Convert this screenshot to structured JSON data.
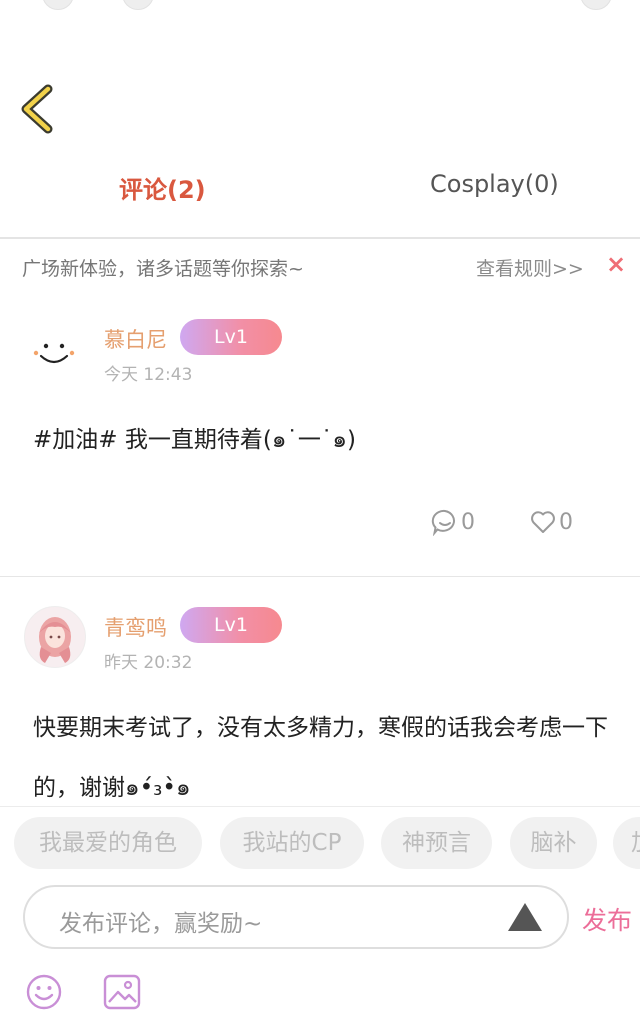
{
  "tabs": [
    {
      "label": "评论(2)",
      "active": true
    },
    {
      "label": "Cosplay(0)",
      "active": false
    }
  ],
  "notice": {
    "text": "广场新体验，诸多话题等你探索~",
    "rules_link": "查看规则>>",
    "close": "×"
  },
  "comments": [
    {
      "username": "慕白尼",
      "level": "Lv1",
      "time": "今天 12:43",
      "text": "#加油# 我一直期待着(๑˙一˙๑)",
      "reply_count": "0",
      "like_count": "0"
    },
    {
      "username": "青鸾鸣",
      "level": "Lv1",
      "time": "昨天 20:32",
      "text": "快要期末考试了，没有太多精力，寒假的话我会考虑一下的，谢谢๑•́₃•̀๑"
    }
  ],
  "topic_chips": [
    "我最爱的角色",
    "我站的CP",
    "神预言",
    "脑补",
    "加"
  ],
  "composer": {
    "placeholder": "发布评论，赢奖励~",
    "publish_label": "发布"
  },
  "colors": {
    "accent": "#d9583f",
    "publish": "#ec6e99",
    "username": "#e59f6f",
    "close": "#ef6e76",
    "icon": "#c98fd6"
  },
  "icons": [
    "back-chevron-icon",
    "close-icon",
    "comment-icon",
    "heart-icon",
    "triangle-icon",
    "smiley-icon",
    "image-icon"
  ]
}
